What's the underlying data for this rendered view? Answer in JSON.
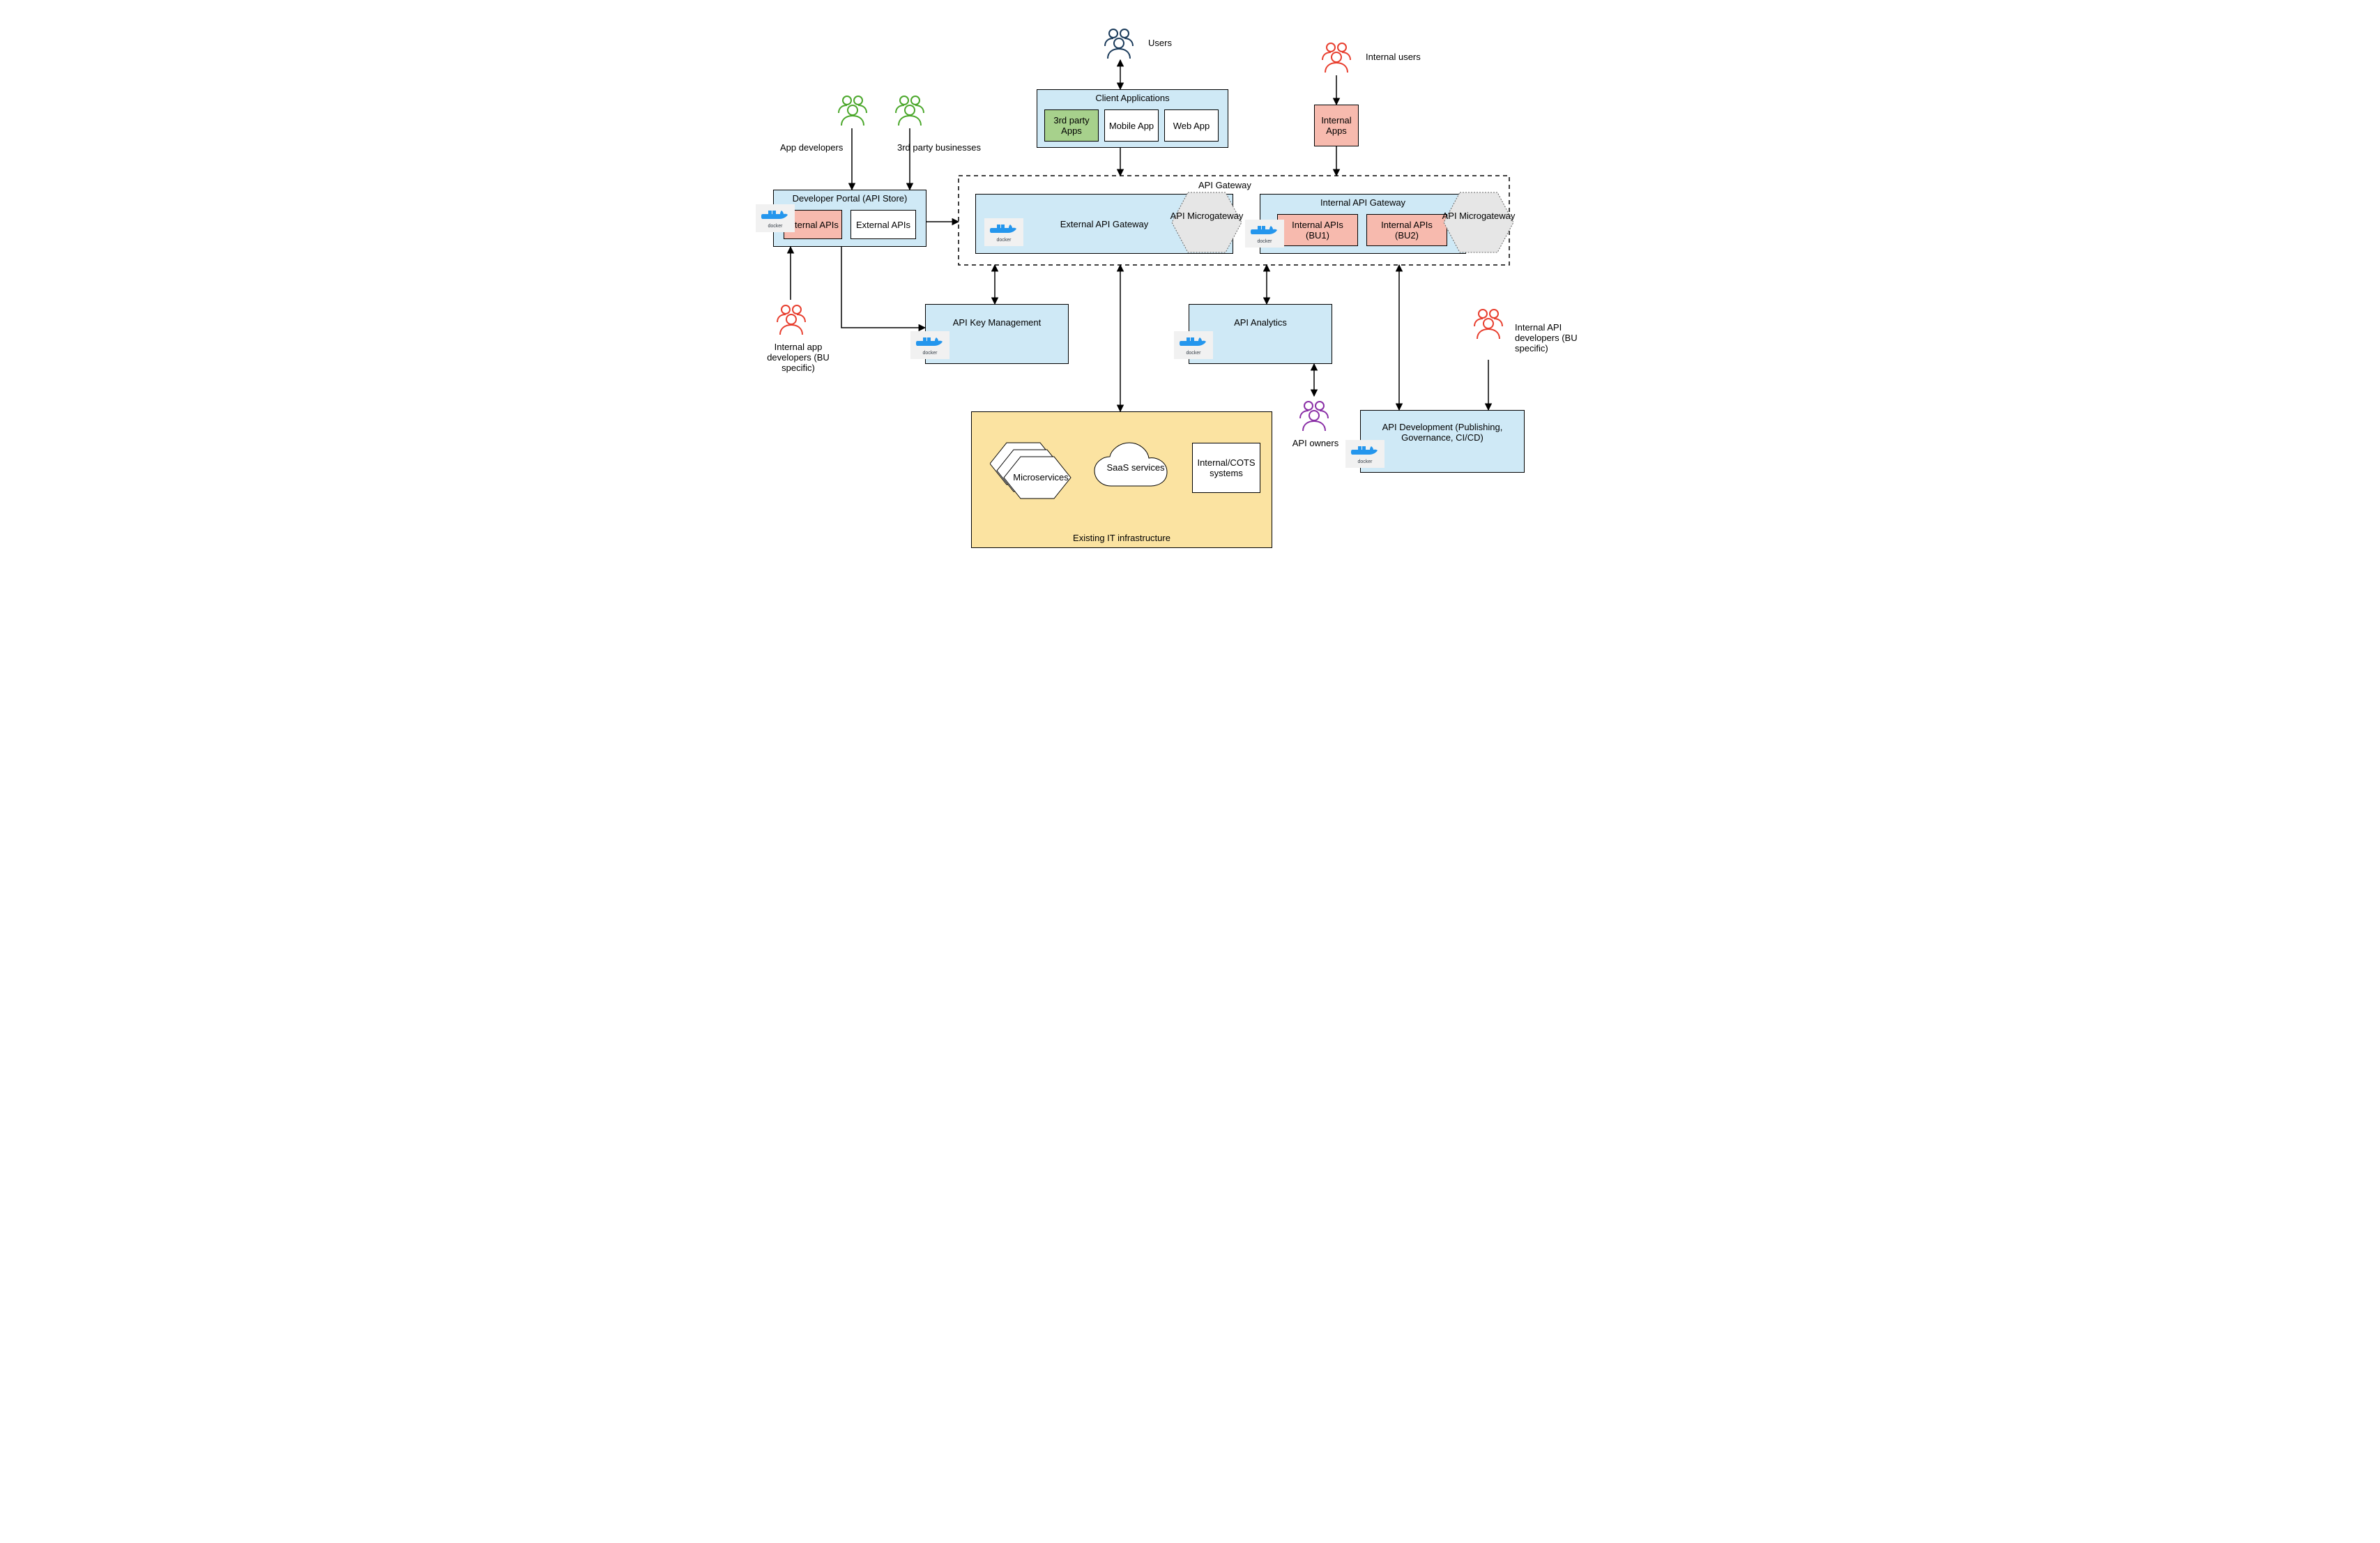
{
  "actors": {
    "users": "Users",
    "internal_users": "Internal users",
    "app_devs": "App developers",
    "third_party": "3rd party businesses",
    "internal_app_devs": "Internal app developers (BU specific)",
    "api_owners": "API owners",
    "internal_api_devs": "Internal API developers (BU specific)"
  },
  "portal": {
    "title": "Developer Portal (API Store)",
    "internal": "Internal APIs",
    "external": "External APIs"
  },
  "client": {
    "title": "Client Applications",
    "third": "3rd party Apps",
    "mobile": "Mobile App",
    "web": "Web App"
  },
  "internal_apps": "Internal Apps",
  "gateway": {
    "title": "API Gateway",
    "external": "External API Gateway",
    "micro": "API Microgateway",
    "internal_title": "Internal API Gateway",
    "bu1": "Internal APIs (BU1)",
    "bu2": "Internal APIs (BU2)"
  },
  "keymgmt": "API Key Management",
  "analytics": "API Analytics",
  "apidev": "API Development (Publishing, Governance, CI/CD)",
  "infra": {
    "title": "Existing IT infrastructure",
    "micro": "Microservices",
    "saas": "SaaS services",
    "cots": "Internal/COTS systems"
  },
  "docker_label": "docker"
}
